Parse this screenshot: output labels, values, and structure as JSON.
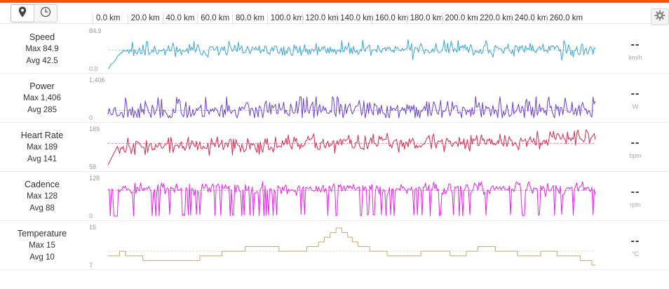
{
  "toolbar": {
    "map_mode_icon": "map-pin-icon",
    "time_mode_icon": "clock-icon",
    "settings_icon": "gear-icon",
    "accent_color": "#fc5200"
  },
  "distance_axis": {
    "ticks": [
      "0.0 km",
      "20.0 km",
      "40.0 km",
      "60.0 km",
      "80.0 km",
      "100.0 km",
      "120.0 km",
      "140.0 km",
      "160.0 km",
      "180.0 km",
      "200.0 km",
      "220.0 km",
      "240.0 km",
      "260.0 km"
    ]
  },
  "streams": [
    {
      "key": "speed",
      "label": "Speed",
      "max_text": "Max 84.9",
      "avg_text": "Avg 42.5",
      "current": "--",
      "unit": "km/h",
      "color": "#3ba4d9",
      "axis_max": "84.9",
      "axis_min": "0.0",
      "max": 84.9,
      "min": 0,
      "avg": 42.5,
      "seed": 11,
      "vol": 7,
      "trend": [
        40,
        41,
        42,
        42,
        44,
        46,
        43,
        45,
        42
      ]
    },
    {
      "key": "power",
      "label": "Power",
      "max_text": "Max 1,406",
      "avg_text": "Avg 285",
      "current": "--",
      "unit": "W",
      "color": "#6a3fd1",
      "axis_max": "1,406",
      "axis_min": "0",
      "max": 1406,
      "min": 0,
      "avg": 285,
      "seed": 23,
      "vol": 180,
      "trend": [
        250,
        270,
        285,
        290,
        300,
        310,
        300,
        290,
        280
      ]
    },
    {
      "key": "heartrate",
      "label": "Heart Rate",
      "max_text": "Max 189",
      "avg_text": "Avg 141",
      "current": "--",
      "unit": "bpm",
      "color": "#d42a4f",
      "axis_max": "189",
      "axis_min": "58",
      "max": 189,
      "min": 58,
      "avg": 141,
      "seed": 37,
      "vol": 14,
      "trend": [
        130,
        132,
        135,
        138,
        142,
        145,
        148,
        155,
        165
      ]
    },
    {
      "key": "cadence",
      "label": "Cadence",
      "max_text": "Max 128",
      "avg_text": "Avg 88",
      "current": "--",
      "unit": "rpm",
      "color": "#e524e6",
      "axis_max": "128",
      "axis_min": "0",
      "max": 128,
      "min": 0,
      "avg": 88,
      "seed": 53,
      "vol": 10,
      "trend": [
        92,
        94,
        95,
        93,
        96,
        94,
        93,
        95,
        94
      ]
    },
    {
      "key": "temperature",
      "label": "Temperature",
      "max_text": "Max 15",
      "avg_text": "Avg 10",
      "current": "--",
      "unit": "°C",
      "color": "#c2ab72",
      "axis_max": "15",
      "axis_min": "7",
      "max": 15,
      "min": 7,
      "avg": 10,
      "seed": 71,
      "vol": 0,
      "trend": []
    }
  ],
  "temperature_profile": [
    9,
    9,
    10,
    9,
    9,
    9,
    8,
    8,
    8,
    8,
    8,
    8,
    8,
    8,
    8,
    8,
    9,
    9,
    9,
    9,
    10,
    10,
    10,
    10,
    11,
    11,
    11,
    11,
    11,
    11,
    10,
    10,
    10,
    10,
    10,
    11,
    11,
    12,
    13,
    14,
    15,
    14,
    13,
    12,
    11,
    11,
    10,
    10,
    10,
    9,
    9,
    9,
    9,
    9,
    9,
    10,
    10,
    10,
    10,
    10,
    9,
    9,
    9,
    10,
    10,
    11,
    11,
    11,
    10,
    10,
    10,
    10,
    9,
    9,
    9,
    9,
    10,
    10,
    10,
    9,
    9,
    9,
    9,
    8,
    8,
    7
  ]
}
